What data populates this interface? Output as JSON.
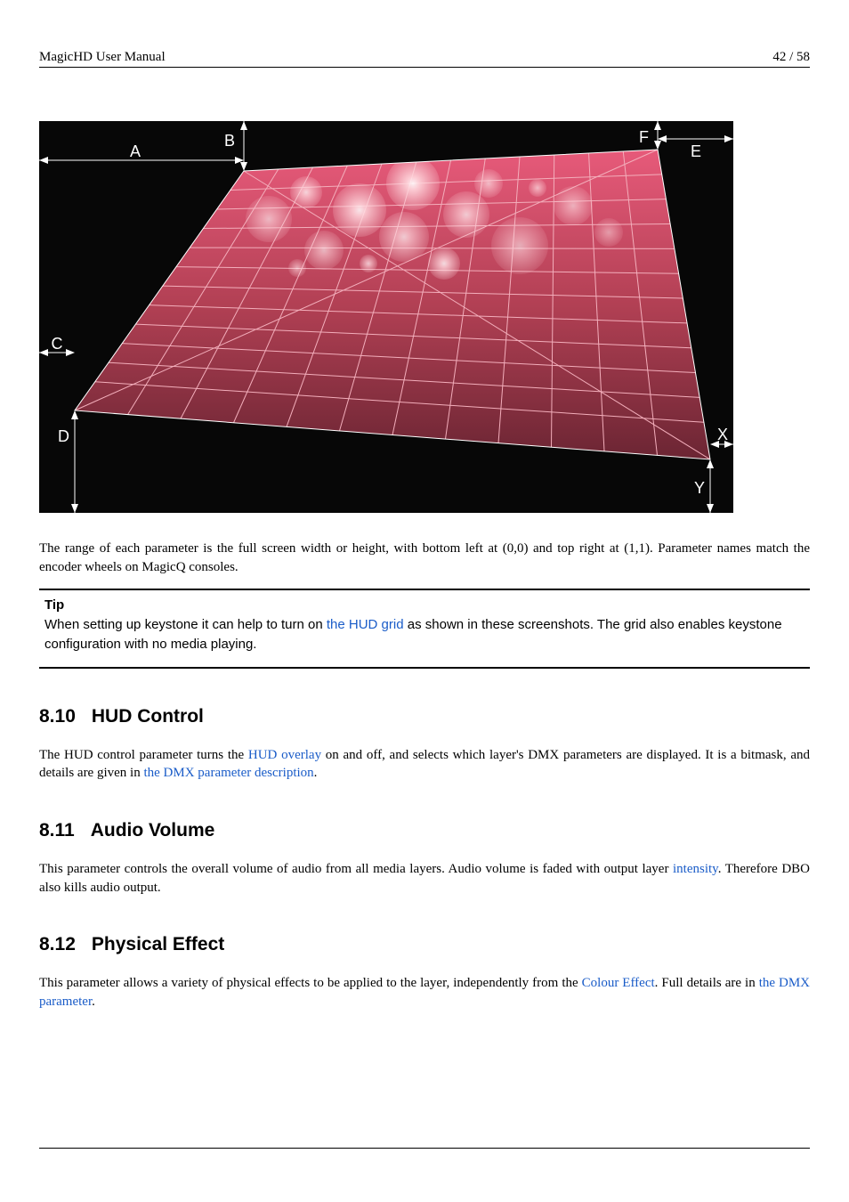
{
  "header": {
    "left": "MagicHD User Manual",
    "right": "42 / 58"
  },
  "figure": {
    "labels": {
      "A": "A",
      "B": "B",
      "C": "C",
      "D": "D",
      "E": "E",
      "F": "F",
      "X": "X",
      "Y": "Y"
    }
  },
  "body": {
    "p_range": "The range of each parameter is the full screen width or height, with bottom left at (0,0) and top right at (1,1). Parameter names match the encoder wheels on MagicQ consoles.",
    "tip_label": "Tip",
    "tip_before_link": "When setting up keystone it can help to turn on ",
    "tip_link": "the HUD grid",
    "tip_after_link": " as shown in these screenshots. The grid also enables keystone configuration with no media playing.",
    "s810_num": "8.10",
    "s810_title": "HUD Control",
    "s810_p_a": "The HUD control parameter turns the ",
    "s810_link1": "HUD overlay",
    "s810_p_b": " on and off, and selects which layer's DMX parameters are displayed. It is a bitmask, and details are given in ",
    "s810_link2": "the DMX parameter description",
    "s810_p_c": ".",
    "s811_num": "8.11",
    "s811_title": "Audio Volume",
    "s811_p_a": "This parameter controls the overall volume of audio from all media layers. Audio volume is faded with output layer ",
    "s811_link": "intensity",
    "s811_p_b": ". Therefore DBO also kills audio output.",
    "s812_num": "8.12",
    "s812_title": "Physical Effect",
    "s812_p_a": "This parameter allows a variety of physical effects to be applied to the layer, independently from the ",
    "s812_link1": "Colour Effect",
    "s812_p_b": ". Full details are in ",
    "s812_link2": "the DMX parameter",
    "s812_p_c": "."
  }
}
